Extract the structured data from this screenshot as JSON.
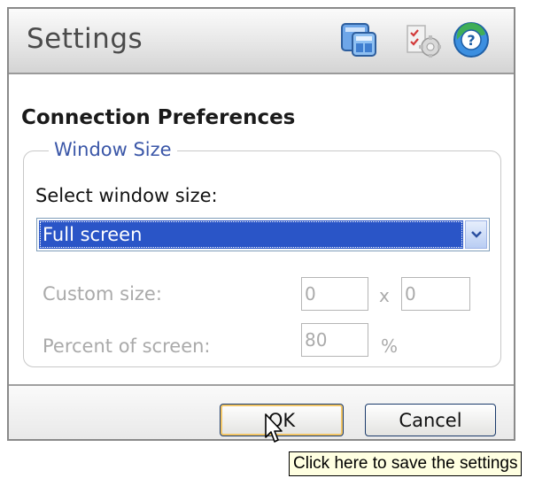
{
  "window": {
    "title": "Settings",
    "icons": [
      "windows-icon",
      "checklist-icon",
      "help-icon"
    ]
  },
  "section": {
    "heading": "Connection Preferences"
  },
  "group": {
    "legend": "Window Size",
    "select_label": "Select window size:",
    "select_value": "Full screen",
    "custom_size_label": "Custom size:",
    "custom_width": "0",
    "custom_sep": "x",
    "custom_height": "0",
    "percent_label": "Percent of screen:",
    "percent_value": "80",
    "percent_unit": "%"
  },
  "buttons": {
    "ok": "OK",
    "cancel": "Cancel"
  },
  "tooltip": {
    "text": "Click here to save the settings"
  },
  "colors": {
    "selection": "#2a55c7",
    "legend": "#3b57a8",
    "disabled_text": "#aaaaaa",
    "tooltip_bg": "#ffffe1",
    "ok_focus_ring": "#f2c566"
  }
}
